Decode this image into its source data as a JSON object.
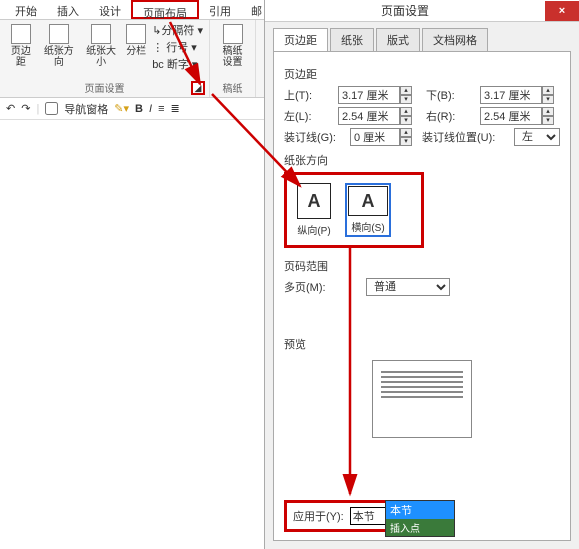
{
  "ribbon": {
    "tabs": [
      "开始",
      "插入",
      "设计",
      "页面布局",
      "引用",
      "邮"
    ],
    "active_index": 3,
    "group_page_title": "页面设置",
    "btn_margins": "页边距",
    "btn_orientation": "纸张方向",
    "btn_size": "纸张大小",
    "btn_columns": "分栏",
    "opt_breaks": "↳分隔符 ▾",
    "opt_linenum": "⋮ 行号 ▾",
    "opt_hyphen": "bc 断字 ▾",
    "group_draft_title": "稿纸",
    "btn_draft": "稿纸\n设置"
  },
  "qat": {
    "nav": "导航窗格",
    "bold": "B",
    "ital": "I"
  },
  "dialog": {
    "title": "页面设置",
    "close": "×",
    "tabs": [
      "页边距",
      "纸张",
      "版式",
      "文档网格"
    ],
    "active_tab": 0,
    "sec_margins": "页边距",
    "top_l": "上(T):",
    "top_v": "3.17 厘米",
    "bottom_l": "下(B):",
    "bottom_v": "3.17 厘米",
    "left_l": "左(L):",
    "left_v": "2.54 厘米",
    "right_l": "右(R):",
    "right_v": "2.54 厘米",
    "gutter_l": "装订线(G):",
    "gutter_v": "0 厘米",
    "gutterpos_l": "装订线位置(U):",
    "gutterpos_v": "左",
    "sec_orient": "纸张方向",
    "orient_portrait": "纵向(P)",
    "orient_landscape": "横向(S)",
    "sec_pages": "页码范围",
    "multi_l": "多页(M):",
    "multi_v": "普通",
    "sec_preview": "预览",
    "apply_l": "应用于(Y):",
    "apply_v": "本节",
    "dd_opts": [
      "本节"
    ],
    "dd_ins": "插入点"
  }
}
